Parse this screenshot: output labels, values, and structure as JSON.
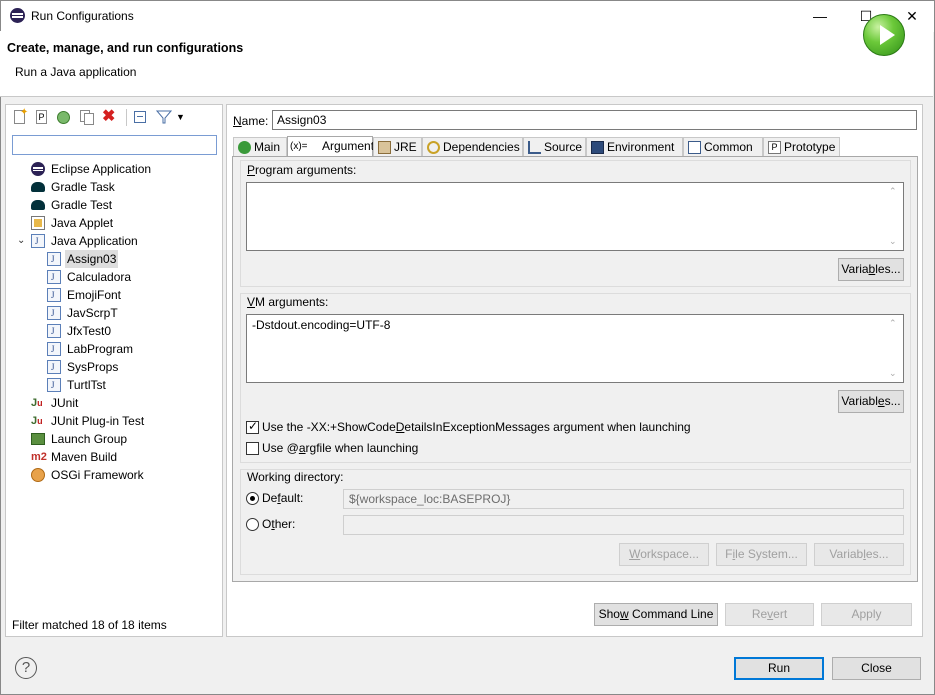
{
  "window": {
    "title": "Run Configurations",
    "minimize_glyph": "—",
    "maximize_glyph": "☐",
    "close_glyph": "✕"
  },
  "header": {
    "title": "Create, manage, and run configurations",
    "subtitle": "Run a Java application"
  },
  "left": {
    "filter_value": "",
    "tree": [
      {
        "label": "Eclipse Application",
        "icon": "eclipse-icon",
        "indent": 0
      },
      {
        "label": "Gradle Task",
        "icon": "gradle-elephant-icon",
        "indent": 0
      },
      {
        "label": "Gradle Test",
        "icon": "gradle-elephant-icon",
        "indent": 0
      },
      {
        "label": "Java Applet",
        "icon": "java-applet-icon",
        "indent": 0
      },
      {
        "label": "Java Application",
        "icon": "java-application-icon",
        "indent": 0,
        "expanded": true
      },
      {
        "label": "Assign03",
        "icon": "java-file-icon",
        "indent": 1,
        "selected": true
      },
      {
        "label": "Calculadora",
        "icon": "java-file-icon",
        "indent": 1
      },
      {
        "label": "EmojiFont",
        "icon": "java-file-icon",
        "indent": 1
      },
      {
        "label": "JavScrpT",
        "icon": "java-file-icon",
        "indent": 1
      },
      {
        "label": "JfxTest0",
        "icon": "java-file-icon",
        "indent": 1
      },
      {
        "label": "LabProgram",
        "icon": "java-file-icon",
        "indent": 1
      },
      {
        "label": "SysProps",
        "icon": "java-file-icon",
        "indent": 1
      },
      {
        "label": "TurtlTst",
        "icon": "java-file-icon",
        "indent": 1
      },
      {
        "label": "JUnit",
        "icon": "junit-icon",
        "indent": 0
      },
      {
        "label": "JUnit Plug-in Test",
        "icon": "junit-plugin-icon",
        "indent": 0
      },
      {
        "label": "Launch Group",
        "icon": "launch-group-icon",
        "indent": 0
      },
      {
        "label": "Maven Build",
        "icon": "maven-icon",
        "indent": 0
      },
      {
        "label": "OSGi Framework",
        "icon": "osgi-icon",
        "indent": 0
      }
    ],
    "status": "Filter matched 18 of 18 items"
  },
  "right": {
    "name_label": "Name:",
    "name_value": "Assign03",
    "tabs": [
      {
        "label": "Main",
        "icon": "main-tab-icon"
      },
      {
        "label": "Arguments",
        "icon": "arguments-tab-icon",
        "icon_text": "(x)=",
        "active": true
      },
      {
        "label": "JRE",
        "icon": "jre-tab-icon"
      },
      {
        "label": "Dependencies",
        "icon": "dependencies-tab-icon"
      },
      {
        "label": "Source",
        "icon": "source-tab-icon"
      },
      {
        "label": "Environment",
        "icon": "environment-tab-icon"
      },
      {
        "label": "Common",
        "icon": "common-tab-icon"
      },
      {
        "label": "Prototype",
        "icon": "prototype-tab-icon",
        "icon_text": "P"
      }
    ],
    "program_args_label": "Program arguments:",
    "program_args_value": "",
    "variables_label": "Variables...",
    "vm_args_label": "VM arguments:",
    "vm_args_value": "-Dstdout.encoding=UTF-8",
    "checkbox_showcode_label": "Use the -XX:+ShowCodeDetailsInExceptionMessages argument when launching",
    "checkbox_showcode_checked": true,
    "checkbox_argfile_label": "Use @argfile when launching",
    "checkbox_argfile_checked": false,
    "workdir_label": "Working directory:",
    "default_label": "Default:",
    "default_value": "${workspace_loc:BASEPROJ}",
    "other_label": "Other:",
    "other_value": "",
    "workspace_btn": "Workspace...",
    "filesystem_btn": "File System...",
    "wd_variables_btn": "Variables...",
    "show_cmd_btn": "Show Command Line",
    "revert_btn": "Revert",
    "apply_btn": "Apply"
  },
  "footer": {
    "help_glyph": "?",
    "run_btn": "Run",
    "close_btn": "Close"
  }
}
